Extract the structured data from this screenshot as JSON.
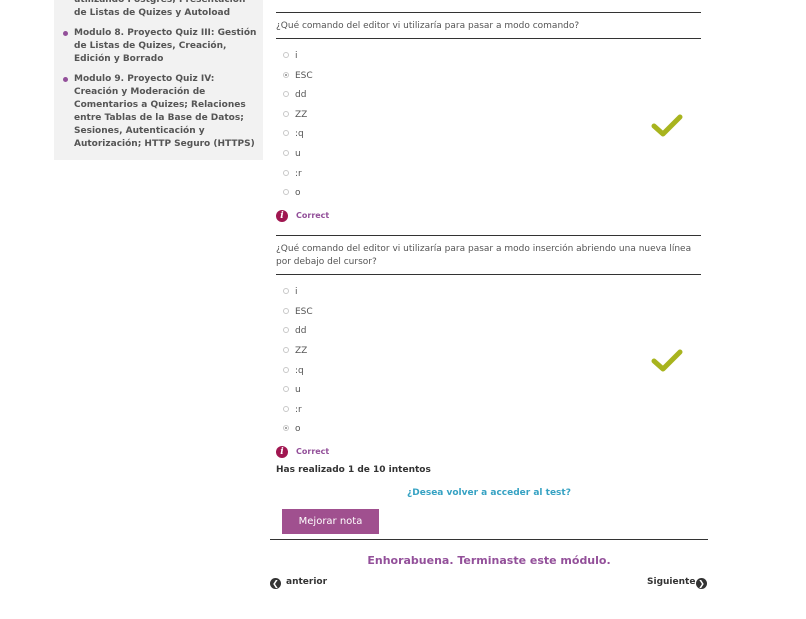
{
  "sidebar": {
    "items": [
      {
        "label": "utilizando Postgres; Presentación de Listas de Quizes y Autoload",
        "bullet": false
      },
      {
        "label": "Modulo 8. Proyecto Quiz III: Gestión de Listas de Quizes, Creación, Edición y Borrado",
        "bullet": true
      },
      {
        "label": "Modulo 9. Proyecto Quiz IV: Creación y Moderación de Comentarios a Quizes; Relaciones entre Tablas de la Base de Datos; Sesiones, Autenticación y Autorización; HTTP Seguro (HTTPS)",
        "bullet": true
      }
    ]
  },
  "questions": [
    {
      "text": "¿Qué comando del editor vi utilizaría para pasar a modo comando?",
      "options": [
        "i",
        "ESC",
        "dd",
        "ZZ",
        ":q",
        "u",
        ":r",
        "o"
      ],
      "selected": "ESC",
      "result_icon": "checkmark-icon",
      "feedback": "Correct"
    },
    {
      "text": "¿Qué comando del editor vi utilizaría para pasar a modo inserción abriendo una nueva línea por debajo del cursor?",
      "options": [
        "i",
        "ESC",
        "dd",
        "ZZ",
        ":q",
        "u",
        ":r",
        "o"
      ],
      "selected": "o",
      "result_icon": "checkmark-icon",
      "feedback": "Correct"
    }
  ],
  "attempts_text": "Has realizado 1 de 10 intentos",
  "retry_link": "¿Desea volver a acceder al test?",
  "improve_button": "Mejorar nota",
  "congrats": "Enhorabuena. Terminaste este módulo.",
  "nav": {
    "prev": "anterior",
    "next": "Siguiente"
  },
  "colors": {
    "accent": "#93509a",
    "check": "#a8b41e",
    "link": "#36a2c3",
    "feedback_icon": "#a01650"
  }
}
